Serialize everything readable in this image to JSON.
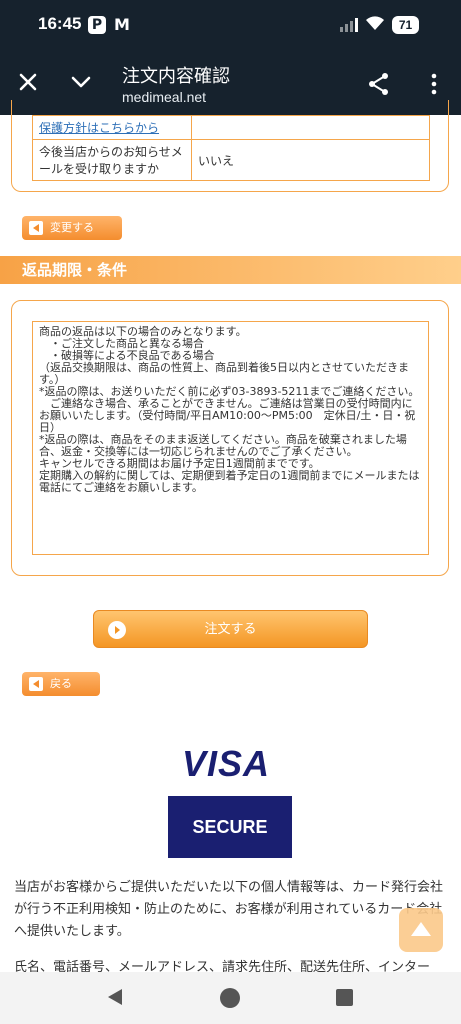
{
  "status_bar": {
    "time": "16:45",
    "battery": "71",
    "icons": [
      "p-app-icon",
      "gmail-icon",
      "signal-icon",
      "wifi-icon",
      "battery-icon"
    ]
  },
  "browser": {
    "title": "注文内容確認",
    "url": "medimeal.net"
  },
  "form_table": {
    "rows": [
      {
        "label": "保護方針はこちらから",
        "value": ""
      },
      {
        "label": "今後当店からのお知らせメールを受け取りますか",
        "value": "いいえ"
      }
    ]
  },
  "buttons": {
    "change": "変更する",
    "order": "注文する",
    "back": "戻る"
  },
  "section": {
    "title": "返品期限・条件"
  },
  "policy": {
    "lines": [
      "商品の返品は以下の場合のみとなります。",
      "　・ご注文した商品と異なる場合",
      "　・破損等による不良品である場合",
      "",
      "（返品交換期限は、商品の性質上、商品到着後5日以内とさせていただきます。）",
      "*返品の際は、お送りいただく前に必ず03-3893-5211までご連絡ください。",
      "　ご連絡なき場合、承ることができません。ご連絡は営業日の受付時間内にお願いいたします。（受付時間/平日AM10:00〜PM5:00　定休日/土・日・祝日）",
      "*返品の際は、商品をそのまま返送してください。商品を破棄されました場合、返金・交換等には一切応じられませんのでご了承ください。",
      "",
      "キャンセルできる期間はお届け予定日1週間前までです。",
      "定期購入の解約に関しては、定期便到着予定日の1週間前までにメールまたは電話にてご連絡をお願いします。"
    ]
  },
  "card": {
    "brand": "VISA",
    "badge": "SECURE"
  },
  "notice": {
    "text": "当店がお客様からご提供いただいた以下の個人情報等は、カード発行会社が行う不正利用検知・防止のために、お客様が利用されているカード会社へ提供いたします。",
    "text2": "氏名、電話番号、メールアドレス、請求先住所、配送先住所、インター"
  },
  "colors": {
    "accent": "#f48d2e",
    "border": "#f5a64b",
    "header_bg": "#16222d",
    "visa_blue": "#1a1f71"
  }
}
